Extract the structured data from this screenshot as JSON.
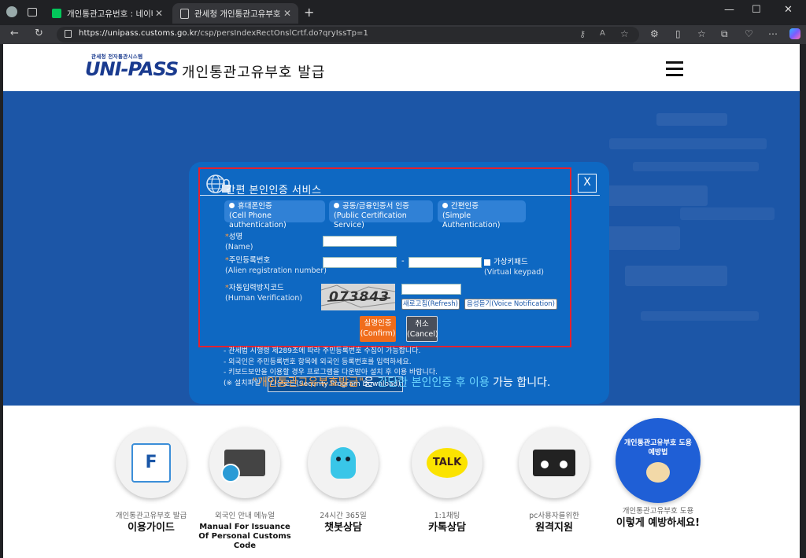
{
  "browser": {
    "tabs": [
      {
        "title": "개인통관고유번호 : 네이버 검색",
        "favicon_color": "#03c75a",
        "active": false
      },
      {
        "title": "관세청 개인통관고유부호",
        "active": true
      }
    ],
    "url_host": "https://unipass.customs.go.kr",
    "url_path": "/csp/persIndexRectOnslCrtf.do?qryIssTp=1"
  },
  "header": {
    "logo_small": "관세청 전자통관시스템",
    "logo_main": "UNI-PASS",
    "title": "개인통관고유부호 발급"
  },
  "modal": {
    "title": "간편 본인인증 서비스",
    "close_label": "X",
    "auth_options": [
      {
        "label": "휴대폰인증",
        "sub": "(Cell Phone authentication)"
      },
      {
        "label": "공동/금융인증서 인증",
        "sub": "(Public Certification Service)"
      },
      {
        "label": "간편인증",
        "sub": "(Simple Authentication)"
      }
    ],
    "name_label": "성명",
    "name_sub": "(Name)",
    "reg_label": "주민등록번호",
    "reg_sub": "(Alien registration number)",
    "reg_dash": "-",
    "keypad_label": "가상키패드",
    "keypad_sub": "(Virtual keypad)",
    "captcha_label": "자동입력방지코드",
    "captcha_sub": "(Human Verification)",
    "captcha_text": "073843",
    "refresh_btn": "새로고침(Refresh)",
    "voice_btn": "음성듣기(Voice Notification)",
    "confirm_label": "실명인증",
    "confirm_sub": "(Confirm)",
    "cancel_label": "취소",
    "cancel_sub": "(Cancel)",
    "notes": [
      "- 관세법 시행령 제289조에 따라 주민등록번호 수집이 가능합니다.",
      "- 외국인은 주민등록번호 항목에 외국인 등록번호를 입력하세요.",
      "- 키보드보안을 이용할 경우 프로그램을 다운받아 설치 후 이용 바랍니다."
    ],
    "install_prefix": "(※ 설치파일",
    "download_btn": "다운로드(Security Program Download)",
    "install_suffix": ")"
  },
  "banner_desc": {
    "part1": "\"개인통관고유부호발급\"",
    "part2": "은 ",
    "part3": "간단한 본인인증 후 이용",
    "part4": " 가능 합니다."
  },
  "services": [
    {
      "sub": "개인통관고유부호 발급",
      "main": "이용가이드",
      "icon": "faq-cube-icon"
    },
    {
      "sub": "외국인 안내 메뉴얼",
      "main": "Manual For Issuance Of Personal Customs Code",
      "icon": "manual-books-icon"
    },
    {
      "sub": "24시간 365일",
      "main": "챗봇상담",
      "icon": "chatbot-mascot-icon"
    },
    {
      "sub": "1:1채팅",
      "main": "카톡상담",
      "icon": "kakao-talk-icon"
    },
    {
      "sub": "pc사용자를위한",
      "main": "원격지원",
      "icon": "remote-support-icon"
    },
    {
      "sub": "개인통관고유부호 도용",
      "main": "이렇게 예방하세요!",
      "icon": "prevention-badge-icon"
    }
  ],
  "badge_text": "개인통관고유부호 도용 예방법"
}
